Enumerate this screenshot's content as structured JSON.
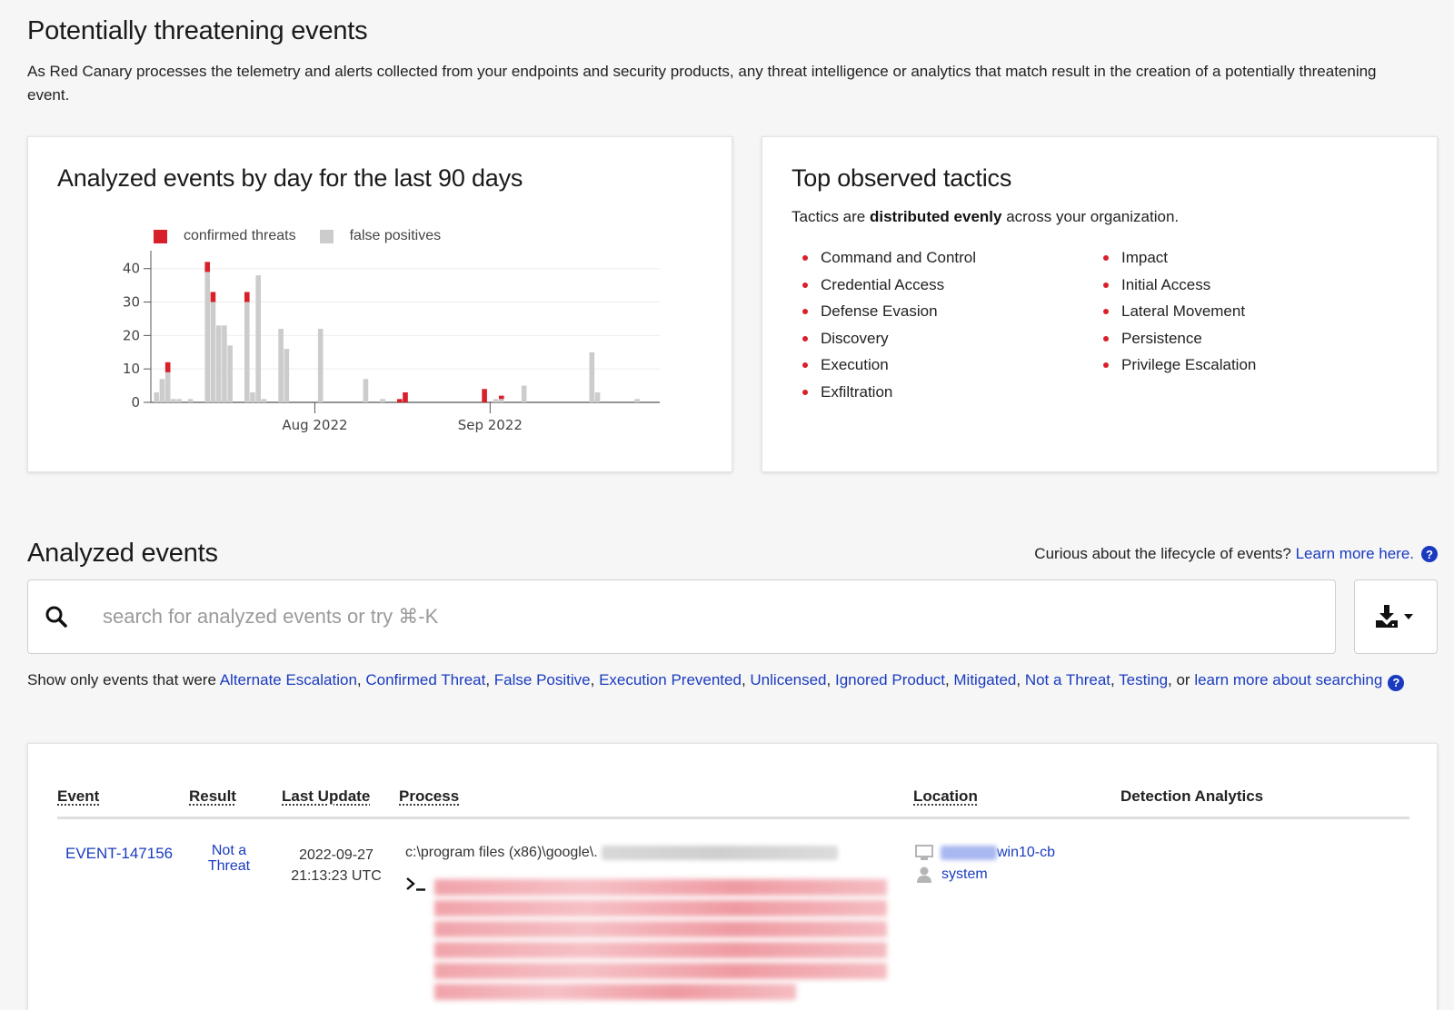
{
  "header": {
    "title": "Potentially threatening events",
    "description": "As Red Canary processes the telemetry and alerts collected from your endpoints and security products, any threat intelligence or analytics that match result in the creation of a potentially threatening event."
  },
  "chart_card": {
    "title": "Analyzed events by day for the last 90 days"
  },
  "chart_data": {
    "type": "bar",
    "stacked": true,
    "legend_position": "top-left",
    "series": [
      {
        "name": "confirmed threats",
        "color": "#d8202a"
      },
      {
        "name": "false positives",
        "color": "#cccccc"
      }
    ],
    "x_tick_labels": [
      "Aug 2022",
      "Sep 2022"
    ],
    "y_ticks": [
      0,
      10,
      20,
      30,
      40
    ],
    "ylim": [
      0,
      44
    ],
    "bars": [
      {
        "day": 1,
        "false_positive": 3,
        "confirmed": 0
      },
      {
        "day": 2,
        "false_positive": 7,
        "confirmed": 0
      },
      {
        "day": 3,
        "false_positive": 9,
        "confirmed": 3
      },
      {
        "day": 4,
        "false_positive": 1,
        "confirmed": 0
      },
      {
        "day": 5,
        "false_positive": 1,
        "confirmed": 0
      },
      {
        "day": 7,
        "false_positive": 1,
        "confirmed": 0
      },
      {
        "day": 10,
        "false_positive": 39,
        "confirmed": 3
      },
      {
        "day": 11,
        "false_positive": 30,
        "confirmed": 3
      },
      {
        "day": 12,
        "false_positive": 23,
        "confirmed": 0
      },
      {
        "day": 13,
        "false_positive": 23,
        "confirmed": 0
      },
      {
        "day": 14,
        "false_positive": 17,
        "confirmed": 0
      },
      {
        "day": 17,
        "false_positive": 30,
        "confirmed": 3
      },
      {
        "day": 18,
        "false_positive": 3,
        "confirmed": 0
      },
      {
        "day": 19,
        "false_positive": 38,
        "confirmed": 0
      },
      {
        "day": 20,
        "false_positive": 1,
        "confirmed": 0
      },
      {
        "day": 23,
        "false_positive": 22,
        "confirmed": 0
      },
      {
        "day": 24,
        "false_positive": 16,
        "confirmed": 0
      },
      {
        "day": 30,
        "false_positive": 22,
        "confirmed": 0
      },
      {
        "day": 38,
        "false_positive": 7,
        "confirmed": 0
      },
      {
        "day": 41,
        "false_positive": 1,
        "confirmed": 0
      },
      {
        "day": 44,
        "false_positive": 0,
        "confirmed": 1
      },
      {
        "day": 45,
        "false_positive": 0,
        "confirmed": 3
      },
      {
        "day": 59,
        "false_positive": 0,
        "confirmed": 4
      },
      {
        "day": 61,
        "false_positive": 1,
        "confirmed": 0
      },
      {
        "day": 62,
        "false_positive": 1,
        "confirmed": 1
      },
      {
        "day": 66,
        "false_positive": 5,
        "confirmed": 0
      },
      {
        "day": 78,
        "false_positive": 15,
        "confirmed": 0
      },
      {
        "day": 79,
        "false_positive": 3,
        "confirmed": 0
      },
      {
        "day": 86,
        "false_positive": 1,
        "confirmed": 0
      }
    ],
    "x_ticks": [
      {
        "day": 29,
        "label": "Aug 2022"
      },
      {
        "day": 60,
        "label": "Sep 2022"
      }
    ],
    "x_range_days": [
      0,
      90
    ],
    "grid": true
  },
  "tactics": {
    "title": "Top observed tactics",
    "summary_prefix": "Tactics are ",
    "summary_bold": "distributed evenly",
    "summary_suffix": " across your organization.",
    "col1": [
      "Command and Control",
      "Credential Access",
      "Defense Evasion",
      "Discovery",
      "Execution",
      "Exfiltration"
    ],
    "col2": [
      "Impact",
      "Initial Access",
      "Lateral Movement",
      "Persistence",
      "Privilege Escalation"
    ]
  },
  "analyzed": {
    "title": "Analyzed events",
    "lifecycle_text": "Curious about the lifecycle of events?",
    "lifecycle_link": "Learn more here.",
    "search_placeholder": "search for analyzed events or try ⌘-K",
    "filters_prefix": "Show only events that were",
    "filters": [
      "Alternate Escalation",
      "Confirmed Threat",
      "False Positive",
      "Execution Prevented",
      "Unlicensed",
      "Ignored Product",
      "Mitigated",
      "Not a Threat",
      "Testing"
    ],
    "filters_or": ", or",
    "filters_learn": "learn more about searching"
  },
  "table": {
    "headers": {
      "event": "Event",
      "result": "Result",
      "last_update": "Last Update",
      "process": "Process",
      "location": "Location",
      "detection": "Detection Analytics"
    },
    "rows": [
      {
        "event": "EVENT-147156",
        "result": "Not a Threat",
        "date": "2022-09-27",
        "time": "21:13:23 UTC",
        "process_path": "c:\\program files (x86)\\google\\.",
        "host": "win10-cb",
        "user": "system"
      }
    ]
  }
}
